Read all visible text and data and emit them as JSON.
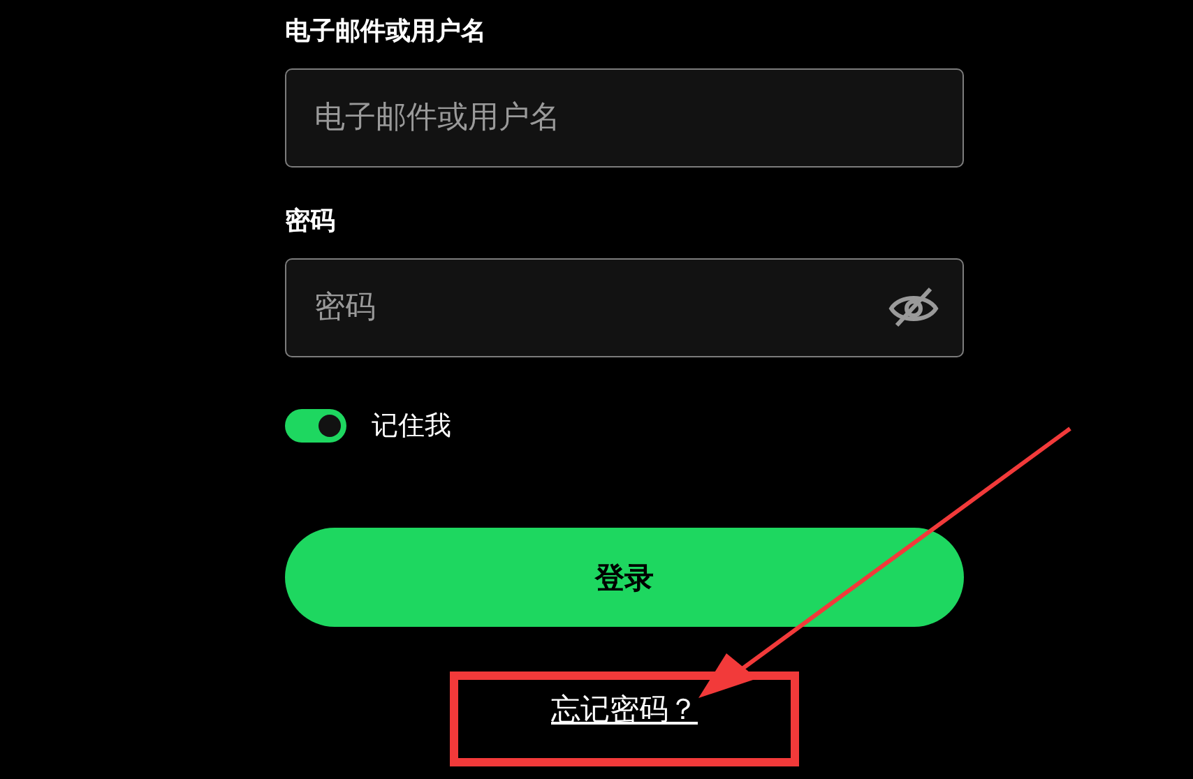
{
  "fields": [
    {
      "label": "电子邮件或用户名",
      "placeholder": "电子邮件或用户名",
      "kind": "text"
    },
    {
      "label": "密码",
      "placeholder": "密码",
      "kind": "password"
    }
  ],
  "remember": {
    "label": "记住我",
    "on": true
  },
  "login_button": "登录",
  "forgot_link": "忘记密码？"
}
